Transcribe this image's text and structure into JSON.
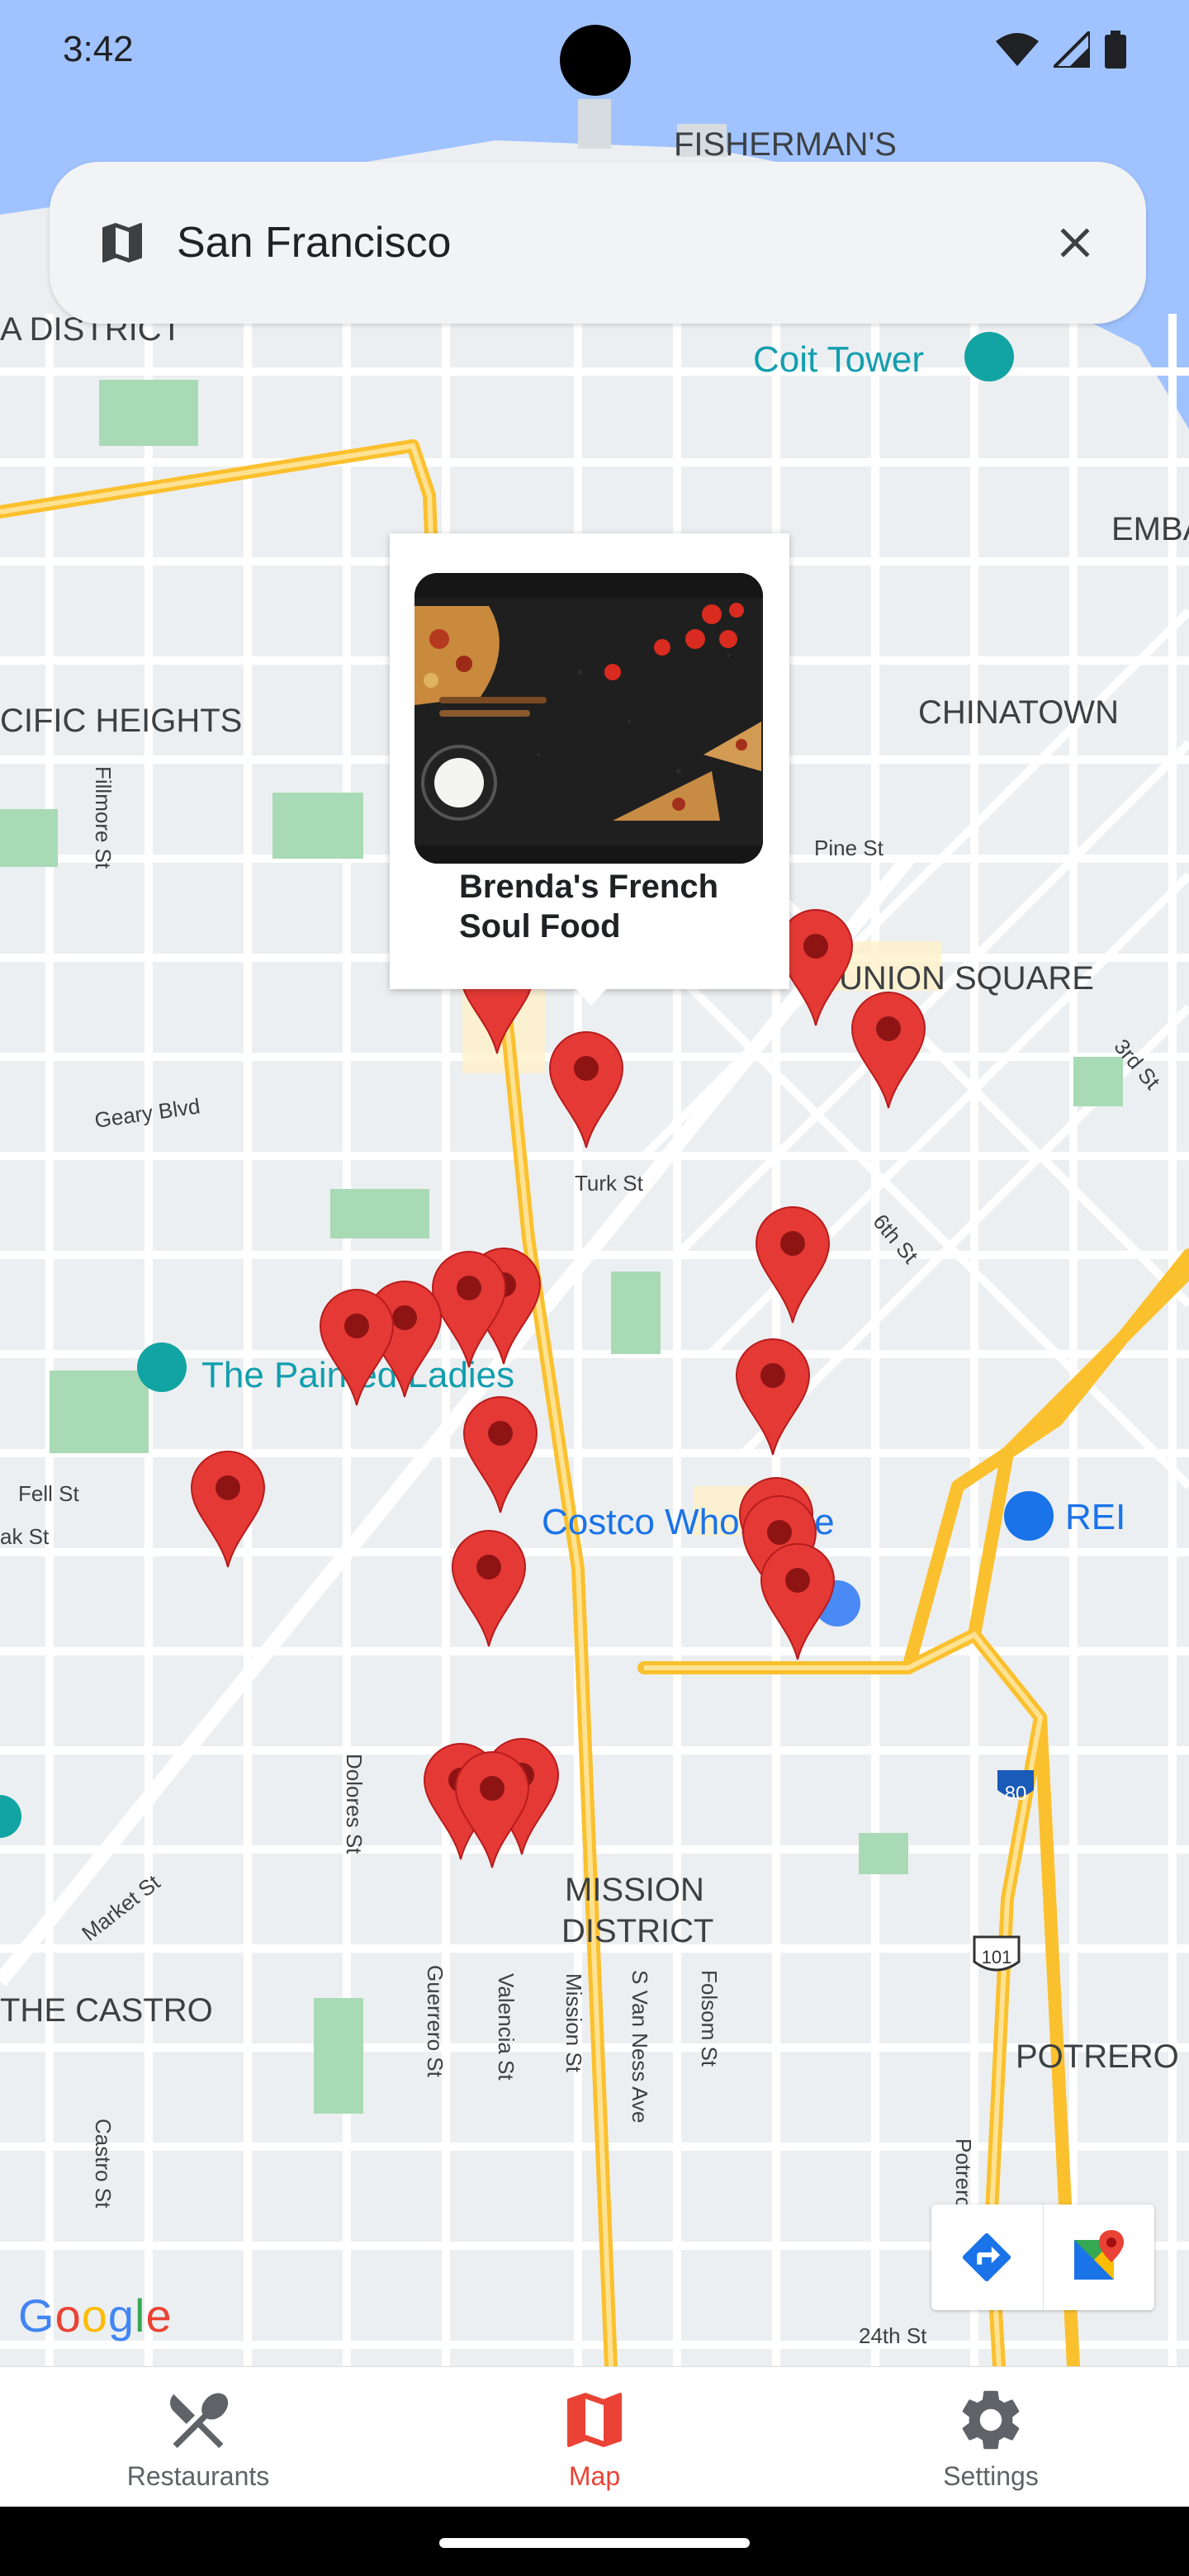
{
  "status_bar": {
    "time": "3:42"
  },
  "search": {
    "text": "San Francisco",
    "map_icon": "map-icon",
    "close_icon": "close-icon"
  },
  "map": {
    "labels": {
      "fishermans": "FISHERMAN'S",
      "district": "A DISTRICT",
      "coit_tower": "Coit Tower",
      "embarcadero": "EMBA",
      "pacific_heights": "CIFIC HEIGHTS",
      "chinatown": "CHINATOWN",
      "fillmore": "Fillmore St",
      "pine": "Pine St",
      "union_square": "UNION SQUARE",
      "third": "3rd St",
      "geary": "Geary Blvd",
      "turk": "Turk St",
      "sixth": "6th St",
      "painted_ladies": "The Painted Ladies",
      "fell": "Fell St",
      "oak": "ak St",
      "costco": "Costco Wholesale",
      "rei": "REI",
      "market": "Market St",
      "dolores": "Dolores St",
      "mission_district_1": "MISSION",
      "mission_district_2": "DISTRICT",
      "castro": "THE CASTRO",
      "guerrero": "Guerrero St",
      "valencia": "Valencia St",
      "mission_st": "Mission St",
      "svanness": "S Van Ness Ave",
      "folsom": "Folsom St",
      "potrero": "POTRERO H",
      "potrero_ave": "Potrero Ave",
      "castro_st": "Castro St",
      "twentyfourth": "24th St",
      "i80": "80",
      "us101": "101"
    },
    "google": "Google"
  },
  "info_window": {
    "name": "Brenda's French Soul Food"
  },
  "bottom_nav": {
    "items": [
      {
        "label": "Restaurants",
        "icon": "fork-knife-icon",
        "active": false
      },
      {
        "label": "Map",
        "icon": "map-icon",
        "active": true
      },
      {
        "label": "Settings",
        "icon": "gear-icon",
        "active": false
      }
    ]
  },
  "colors": {
    "accent": "#ea4335",
    "marker": "#e53935",
    "highway": "#fbc02d",
    "water": "#a0c3ff",
    "park": "#a8dab5"
  }
}
